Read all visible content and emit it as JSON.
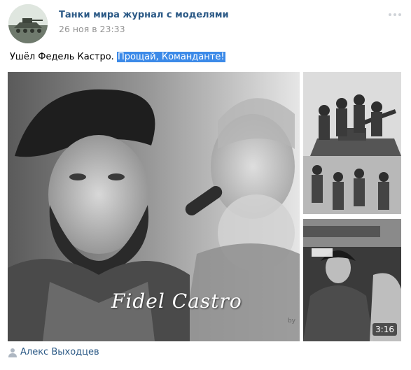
{
  "post": {
    "group_name": "Танки мира журнал с моделями",
    "date": "26 ноя в 23:33",
    "text_plain": "Ушёл Федель Кастро.",
    "text_highlighted": "Прощай, Команданте!",
    "author": "Алекс Выходцев"
  },
  "attachments": {
    "main_photo_caption": "Fidel Castro",
    "main_photo_signature": "by",
    "video_duration": "3:16"
  },
  "colors": {
    "link": "#2a5885",
    "date": "#939393",
    "highlight": "#3c8ae8"
  },
  "icons": {
    "more": "more-dots-icon",
    "author": "user-icon"
  }
}
